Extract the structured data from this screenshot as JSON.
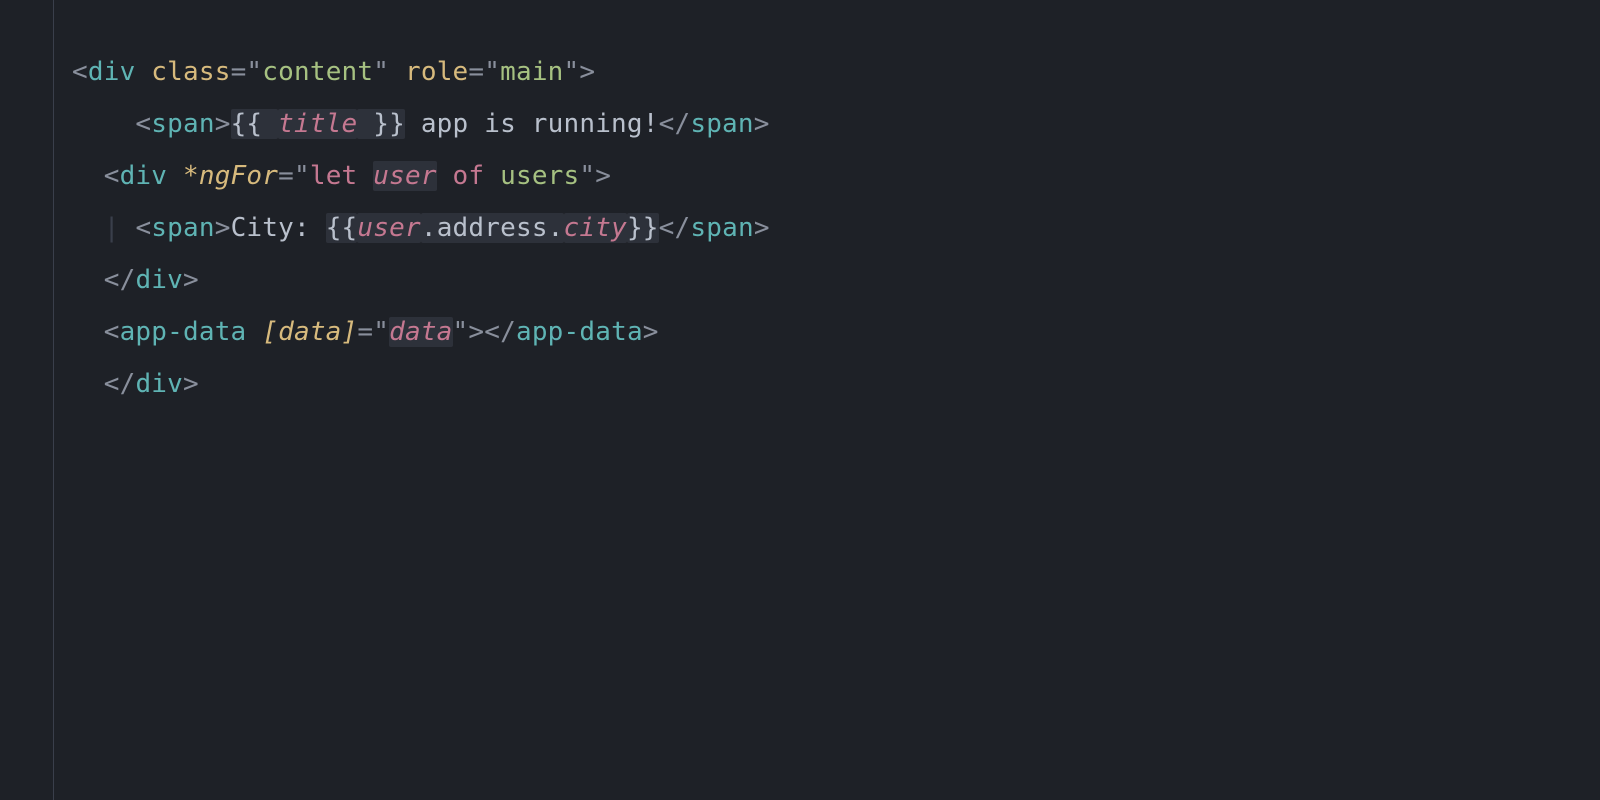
{
  "code": {
    "lang": "angular-html",
    "lines": [
      {
        "indent": 0,
        "tokens": [
          {
            "c": "punct",
            "t": "<"
          },
          {
            "c": "tag",
            "t": "div"
          },
          {
            "c": "txt",
            "t": " "
          },
          {
            "c": "attr",
            "t": "class"
          },
          {
            "c": "punct",
            "t": "="
          },
          {
            "c": "punct",
            "t": "\""
          },
          {
            "c": "str",
            "t": "content"
          },
          {
            "c": "punct",
            "t": "\""
          },
          {
            "c": "txt",
            "t": " "
          },
          {
            "c": "attr",
            "t": "role"
          },
          {
            "c": "punct",
            "t": "="
          },
          {
            "c": "punct",
            "t": "\""
          },
          {
            "c": "str",
            "t": "main"
          },
          {
            "c": "punct",
            "t": "\""
          },
          {
            "c": "punct",
            "t": ">"
          }
        ]
      },
      {
        "indent": 4,
        "tokens": [
          {
            "c": "punct",
            "t": "<"
          },
          {
            "c": "tag",
            "t": "span"
          },
          {
            "c": "punct",
            "t": ">"
          },
          {
            "c": "txt",
            "t": "{{ ",
            "hl": true
          },
          {
            "c": "var",
            "t": "title",
            "hl": true
          },
          {
            "c": "txt",
            "t": " }}",
            "hl": true
          },
          {
            "c": "txt",
            "t": " app is running!"
          },
          {
            "c": "punct",
            "t": "</"
          },
          {
            "c": "tag",
            "t": "span"
          },
          {
            "c": "punct",
            "t": ">"
          }
        ]
      },
      {
        "indent": 2,
        "tokens": [
          {
            "c": "punct",
            "t": "<"
          },
          {
            "c": "tag",
            "t": "div"
          },
          {
            "c": "txt",
            "t": " "
          },
          {
            "c": "attr-it",
            "t": "*ngFor"
          },
          {
            "c": "punct",
            "t": "="
          },
          {
            "c": "punct",
            "t": "\""
          },
          {
            "c": "kw",
            "t": "let"
          },
          {
            "c": "str",
            "t": " "
          },
          {
            "c": "var",
            "t": "user",
            "hl": true
          },
          {
            "c": "str",
            "t": " "
          },
          {
            "c": "kw",
            "t": "of"
          },
          {
            "c": "str",
            "t": " users"
          },
          {
            "c": "punct",
            "t": "\""
          },
          {
            "c": "punct",
            "t": ">"
          }
        ]
      },
      {
        "indent": 2,
        "guide": true,
        "postGuideIndent": 1,
        "tokens": [
          {
            "c": "punct",
            "t": "<"
          },
          {
            "c": "tag",
            "t": "span"
          },
          {
            "c": "punct",
            "t": ">"
          },
          {
            "c": "txt",
            "t": "City: "
          },
          {
            "c": "txt",
            "t": "{{",
            "hl": true
          },
          {
            "c": "var",
            "t": "user",
            "hl": true
          },
          {
            "c": "prop",
            "t": ".address.",
            "hl": true
          },
          {
            "c": "var",
            "t": "city",
            "hl": true
          },
          {
            "c": "txt",
            "t": "}}",
            "hl": true
          },
          {
            "c": "punct",
            "t": "</"
          },
          {
            "c": "tag",
            "t": "span"
          },
          {
            "c": "punct",
            "t": ">"
          }
        ]
      },
      {
        "indent": 2,
        "tokens": [
          {
            "c": "punct",
            "t": "</"
          },
          {
            "c": "tag",
            "t": "div"
          },
          {
            "c": "punct",
            "t": ">"
          }
        ]
      },
      {
        "indent": 2,
        "tokens": [
          {
            "c": "punct",
            "t": "<"
          },
          {
            "c": "tag",
            "t": "app-data"
          },
          {
            "c": "txt",
            "t": " "
          },
          {
            "c": "attr-it",
            "t": "[data]"
          },
          {
            "c": "punct",
            "t": "="
          },
          {
            "c": "punct",
            "t": "\""
          },
          {
            "c": "var",
            "t": "data",
            "hl": true
          },
          {
            "c": "punct",
            "t": "\""
          },
          {
            "c": "punct",
            "t": ">"
          },
          {
            "c": "punct",
            "t": "</"
          },
          {
            "c": "tag",
            "t": "app-data"
          },
          {
            "c": "punct",
            "t": ">"
          }
        ]
      },
      {
        "indent": 2,
        "tokens": [
          {
            "c": "punct",
            "t": "</"
          },
          {
            "c": "tag",
            "t": "div"
          },
          {
            "c": "punct",
            "t": ">"
          }
        ]
      }
    ]
  }
}
